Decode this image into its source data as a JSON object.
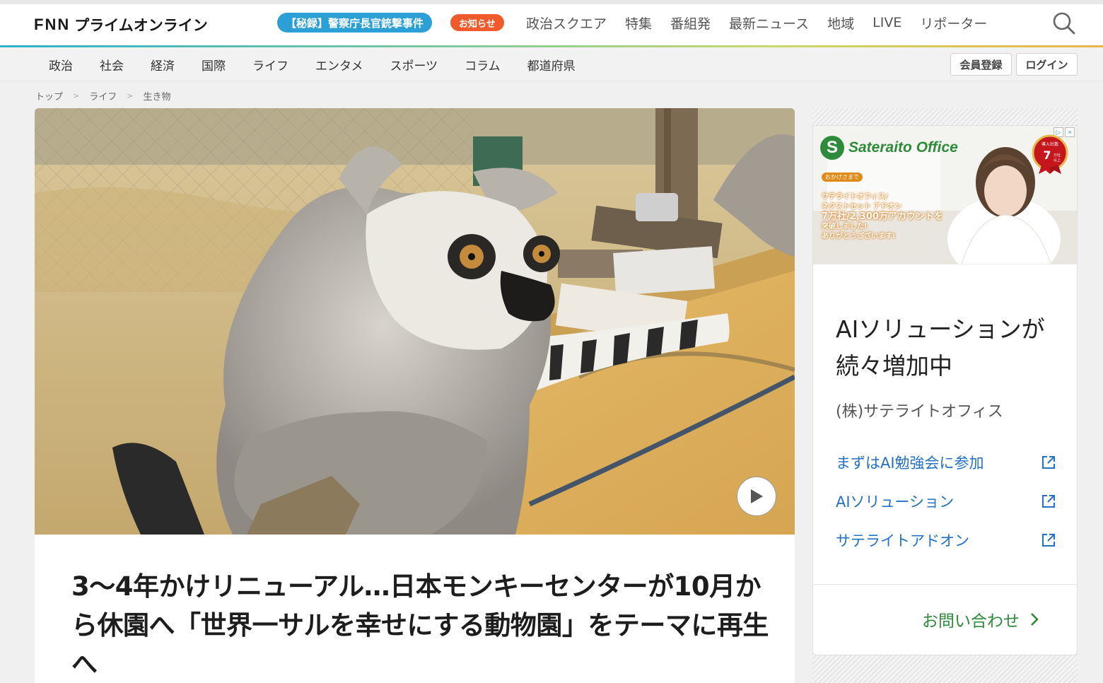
{
  "header": {
    "logo_prefix": "FNN",
    "logo_text": "プライムオンライン",
    "special_badge": "【秘録】警察庁長官銃撃事件",
    "notice_badge": "お知らせ",
    "nav": [
      "政治スクエア",
      "特集",
      "番組発",
      "最新ニュース",
      "地域",
      "LIVE",
      "リポーター"
    ],
    "search_icon": "search-icon"
  },
  "subnav": {
    "categories": [
      "政治",
      "社会",
      "経済",
      "国際",
      "ライフ",
      "エンタメ",
      "スポーツ",
      "コラム",
      "都道府県"
    ],
    "register": "会員登録",
    "login": "ログイン"
  },
  "breadcrumb": [
    "トップ",
    "ライフ",
    "生き物"
  ],
  "hero": {
    "play_icon": "play-icon"
  },
  "article": {
    "headline": "3～4年かけリニューアル…日本モンキーセンターが10月から休園へ「世界一サルを幸せにする動物園」をテーマに再生へ"
  },
  "ad": {
    "banner": {
      "brand": "Sateraito Office",
      "brand_kana": "サテライトオフィス",
      "kicker": "おかげさまで",
      "line1": "サテライトオフィス/",
      "line2": "ネクストセット アドオン",
      "line3": "7万社/2,300万アカウントを",
      "line4": "突破しました!",
      "line5": "ありがとうございます!",
      "medal_top": "導入社数",
      "medal_num": "7",
      "medal_unit": "万社",
      "medal_bottom": "以上"
    },
    "title": "AIソリューションが続々増加中",
    "company": "(株)サテライトオフィス",
    "links": [
      "まずはAI勉強会に参加",
      "AIソリューション",
      "サテライトアドオン"
    ],
    "cta": "お問い合わせ",
    "colors": {
      "link": "#2471c8",
      "cta": "#2e8b3a",
      "brand": "#2e8b3a"
    }
  },
  "colors": {
    "special_badge": "#2b9fd6",
    "notice_badge": "#f15a2b"
  }
}
